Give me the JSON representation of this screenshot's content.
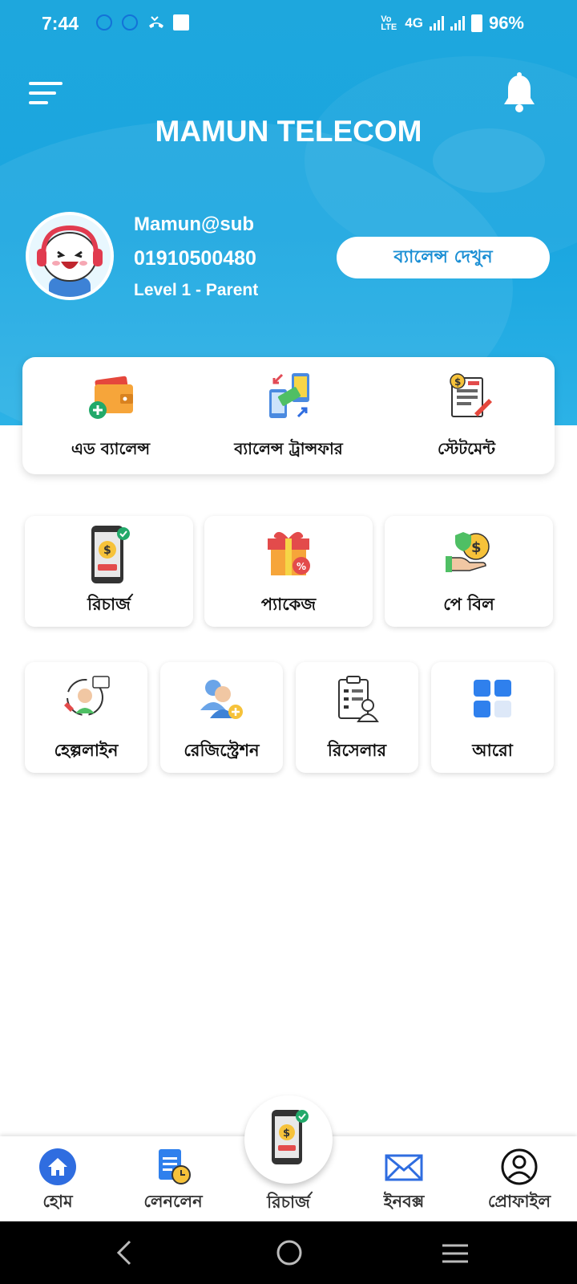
{
  "status_bar": {
    "time": "7:44",
    "network": "4G",
    "volte": "VoLTE1",
    "battery": "96%"
  },
  "header": {
    "app_title": "MAMUN TELECOM",
    "menu_icon": "menu-icon",
    "notification_icon": "bell-icon"
  },
  "user": {
    "name": "Mamun@sub",
    "phone": "01910500480",
    "level": "Level 1 - Parent",
    "balance_button": "ব্যালেন্স দেখুন"
  },
  "quick_actions": [
    {
      "label": "এড ব্যালেন্স",
      "icon": "wallet-add-icon"
    },
    {
      "label": "ব্যালেন্স ট্রান্সফার",
      "icon": "transfer-icon"
    },
    {
      "label": "স্টেটমেন্ট",
      "icon": "statement-icon"
    }
  ],
  "services_row1": [
    {
      "label": "রিচার্জ",
      "icon": "recharge-phone-icon"
    },
    {
      "label": "প্যাকেজ",
      "icon": "gift-package-icon"
    },
    {
      "label": "পে বিল",
      "icon": "pay-bill-icon"
    }
  ],
  "services_row2": [
    {
      "label": "হেল্পলাইন",
      "icon": "helpline-icon"
    },
    {
      "label": "রেজিস্ট্রেশন",
      "icon": "registration-icon"
    },
    {
      "label": "রিসেলার",
      "icon": "reseller-icon"
    },
    {
      "label": "আরো",
      "icon": "more-grid-icon"
    }
  ],
  "bottom_nav": [
    {
      "label": "হোম",
      "icon": "home-icon"
    },
    {
      "label": "লেনলেন",
      "icon": "transactions-icon"
    },
    {
      "label": "রিচার্জ",
      "icon": "recharge-fab-icon"
    },
    {
      "label": "ইনবক্স",
      "icon": "mail-icon"
    },
    {
      "label": "প্রোফাইল",
      "icon": "profile-icon"
    }
  ],
  "colors": {
    "header_blue": "#1ea7dd",
    "accent_blue": "#1b8fd4",
    "home_active": "#2f6de0"
  }
}
